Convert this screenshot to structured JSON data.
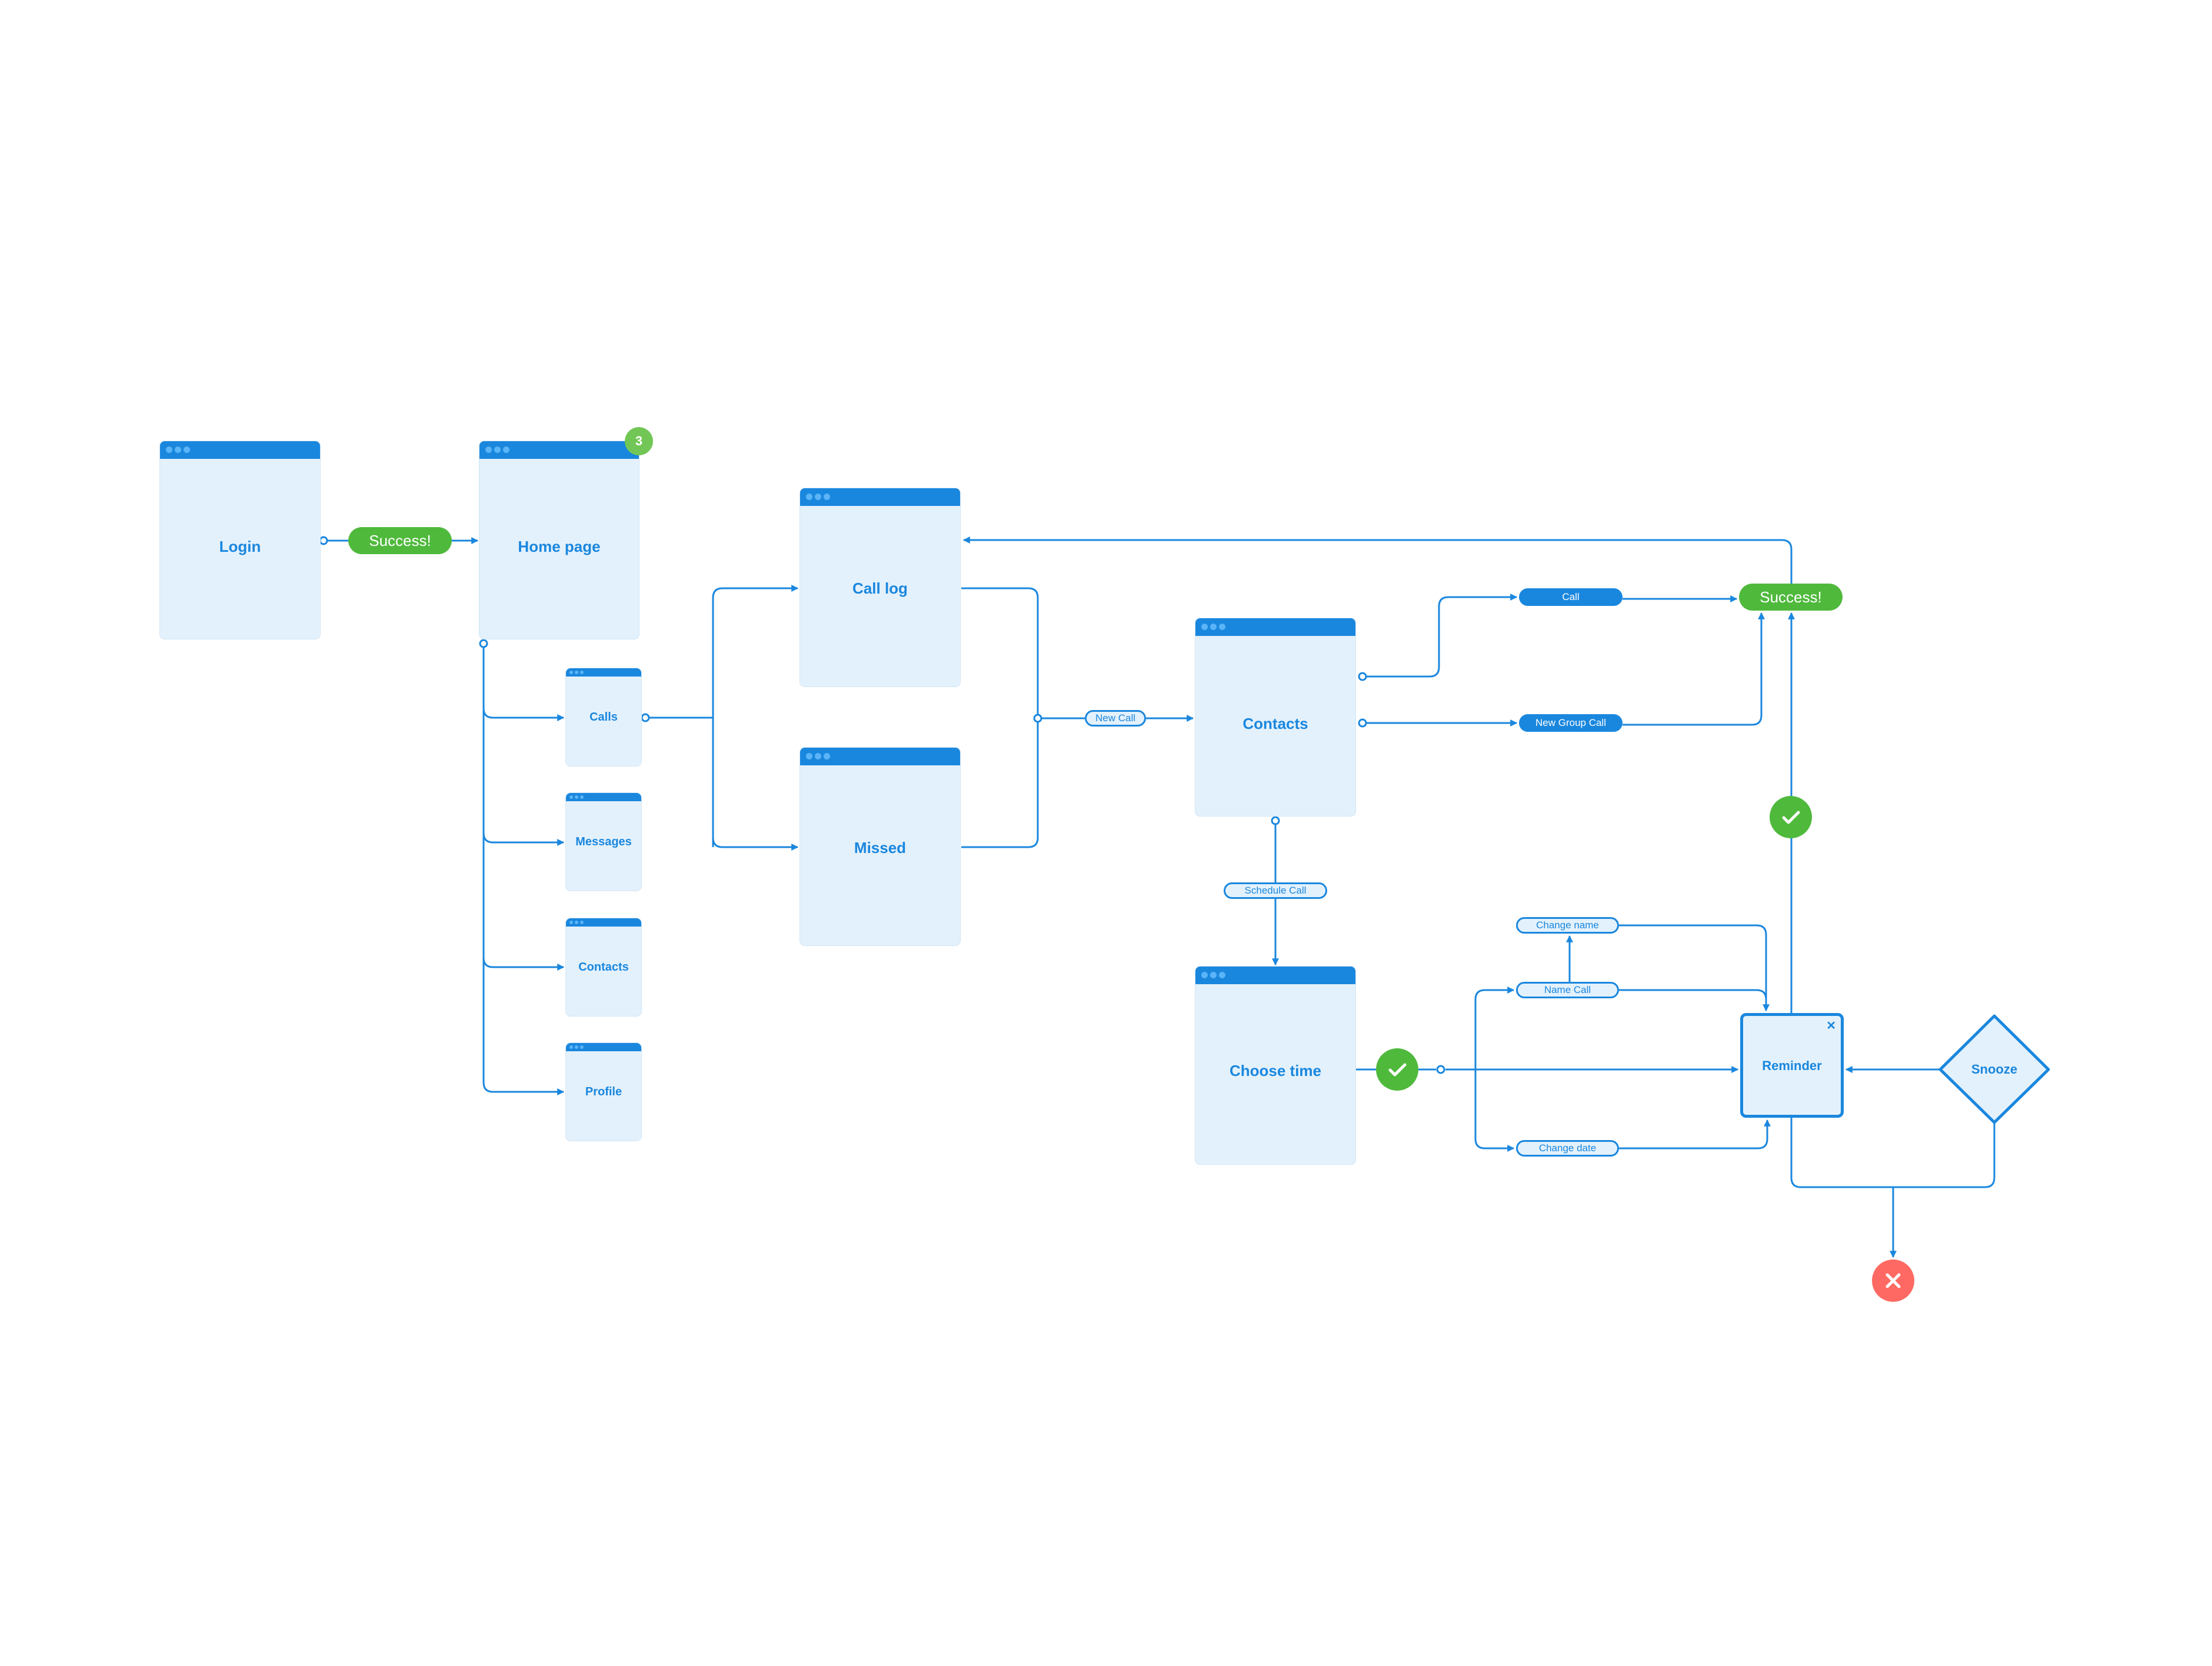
{
  "colors": {
    "primary": "#1a87de",
    "window_body": "#e3f1fc",
    "window_dots": "#5ab4f7",
    "success": "#4fb93c",
    "badge": "#72c655",
    "error": "#fe6a63"
  },
  "screens": {
    "login": {
      "title": "Login"
    },
    "home": {
      "title": "Home page",
      "badge": "3"
    },
    "calls": {
      "title": "Calls"
    },
    "messages": {
      "title": "Messages"
    },
    "contacts_small": {
      "title": "Contacts"
    },
    "profile": {
      "title": "Profile"
    },
    "call_log": {
      "title": "Call log"
    },
    "missed": {
      "title": "Missed"
    },
    "contacts": {
      "title": "Contacts"
    },
    "choose_time": {
      "title": "Choose time"
    }
  },
  "labels": {
    "success_login": "Success!",
    "new_call": "New Call",
    "schedule_call": "Schedule Call",
    "call": "Call",
    "new_group_call": "New Group Call",
    "success_call": "Success!",
    "change_name": "Change name",
    "name_call": "Name Call",
    "change_date": "Change date"
  },
  "nodes": {
    "reminder": {
      "title": "Reminder",
      "close_glyph": "✕"
    },
    "snooze": {
      "title": "Snooze"
    },
    "check_icon": "check-icon",
    "error_icon": "x-icon"
  }
}
